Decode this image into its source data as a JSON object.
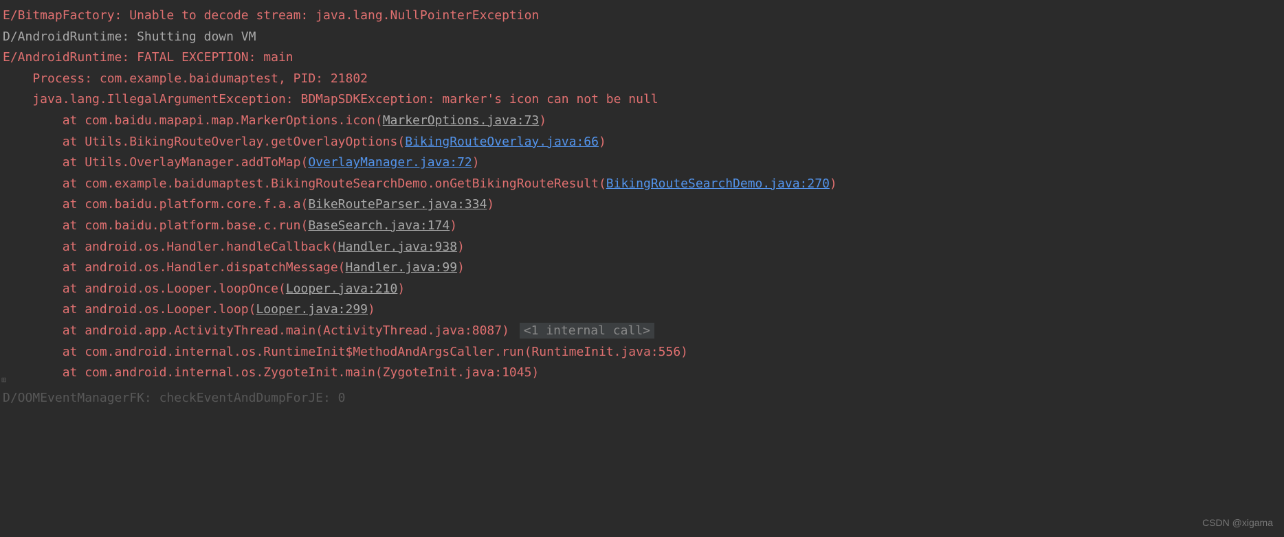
{
  "lines": {
    "l0": {
      "tag": "E/BitmapFactory:",
      "msg": " Unable to decode stream: java.lang.NullPointerException"
    },
    "l1": {
      "tag": "D/AndroidRuntime:",
      "msg": " Shutting down VM"
    },
    "l2": {
      "tag": "E/AndroidRuntime:",
      "msg": " FATAL EXCEPTION: main"
    },
    "l3": "    Process: com.example.baidumaptest, PID: 21802",
    "l4": "    java.lang.IllegalArgumentException: BDMapSDKException: marker's icon can not be null",
    "l5": {
      "pre": "        at com.baidu.mapapi.map.MarkerOptions.icon(",
      "link": "MarkerOptions.java:73",
      "post": ")"
    },
    "l6": {
      "pre": "        at Utils.BikingRouteOverlay.getOverlayOptions(",
      "link": "BikingRouteOverlay.java:66",
      "post": ")"
    },
    "l7": {
      "pre": "        at Utils.OverlayManager.addToMap(",
      "link": "OverlayManager.java:72",
      "post": ")"
    },
    "l8": {
      "pre": "        at com.example.baidumaptest.BikingRouteSearchDemo.onGetBikingRouteResult(",
      "link": "BikingRouteSearchDemo.java:270",
      "post": ")"
    },
    "l9": {
      "pre": "        at com.baidu.platform.core.f.a.a(",
      "link": "BikeRouteParser.java:334",
      "post": ")"
    },
    "l10": {
      "pre": "        at com.baidu.platform.base.c.run(",
      "link": "BaseSearch.java:174",
      "post": ")"
    },
    "l11": {
      "pre": "        at android.os.Handler.handleCallback(",
      "link": "Handler.java:938",
      "post": ")"
    },
    "l12": {
      "pre": "        at android.os.Handler.dispatchMessage(",
      "link": "Handler.java:99",
      "post": ")"
    },
    "l13": {
      "pre": "        at android.os.Looper.loopOnce(",
      "link": "Looper.java:210",
      "post": ")"
    },
    "l14": {
      "pre": "        at android.os.Looper.loop(",
      "link": "Looper.java:299",
      "post": ")"
    },
    "l15": {
      "pre": "        at android.app.ActivityThread.main(ActivityThread.java:8087)",
      "fold": "<1 internal call>"
    },
    "l16": "        at com.android.internal.os.RuntimeInit$MethodAndArgsCaller.run(RuntimeInit.java:556)",
    "l17": "        at com.android.internal.os.ZygoteInit.main(ZygoteInit.java:1045)"
  },
  "partial": "D/OOMEventManagerFK: checkEventAndDumpForJE: 0",
  "watermark": "CSDN @xigama",
  "gutter": "⊞"
}
